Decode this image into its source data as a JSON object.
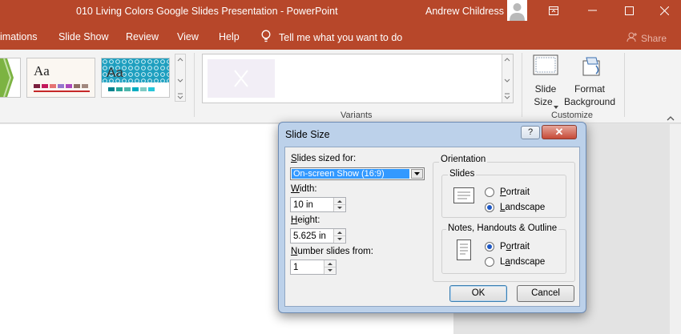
{
  "titlebar": {
    "title": "010 Living Colors Google Slides Presentation  -  PowerPoint",
    "user": "Andrew Childress"
  },
  "tabs": [
    "imations",
    "Slide Show",
    "Review",
    "View",
    "Help"
  ],
  "tell_me": "Tell me what you want to do",
  "share": "Share",
  "ribbon": {
    "theme_sample": "Aa",
    "variants_label": "Variants",
    "customize_label": "Customize",
    "slide_size_line1": "Slide",
    "slide_size_line2": "Size",
    "format_bg_line1": "Format",
    "format_bg_line2": "Background"
  },
  "dialog": {
    "title": "Slide Size",
    "help": "?",
    "close": "✕",
    "slides_sized_for_label": "Slides sized for:",
    "slides_sized_for_value": "On-screen Show (16:9)",
    "width_label": "Width:",
    "width_value": "10 in",
    "height_label": "Height:",
    "height_value": "5.625 in",
    "number_from_label": "Number slides from:",
    "number_from_value": "1",
    "orientation_label": "Orientation",
    "slides_group": "Slides",
    "notes_group": "Notes, Handouts & Outline",
    "portrait": "Portrait",
    "landscape": "Landscape",
    "slides_orientation": "Landscape",
    "notes_orientation": "Portrait",
    "ok": "OK",
    "cancel": "Cancel"
  },
  "colors": {
    "accent": "#b7472a",
    "selection": "#3399ff"
  }
}
